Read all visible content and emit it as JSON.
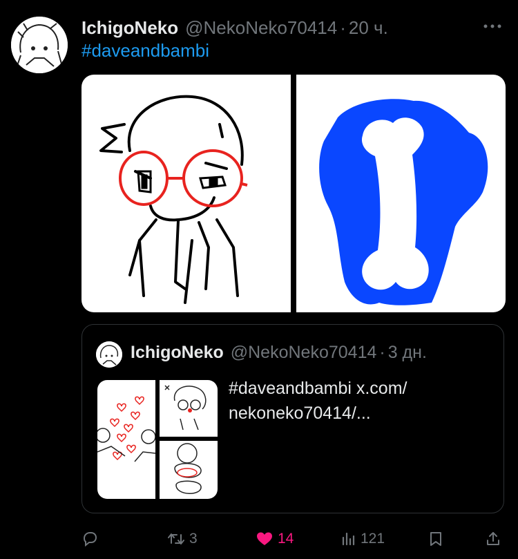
{
  "tweet": {
    "author_name": "IchigoNeko",
    "author_handle": "@NekoNeko70414",
    "separator": "·",
    "time": "20 ч.",
    "hashtag": "#daveandbambi"
  },
  "quote": {
    "author_name": "IchigoNeko",
    "author_handle": "@NekoNeko70414",
    "separator": "·",
    "time": "3 дн.",
    "text_line1": "#daveandbambi x.com/",
    "text_line2": "nekoneko70414/..."
  },
  "actions": {
    "retweets": "3",
    "likes": "14",
    "views": "121"
  },
  "colors": {
    "background": "#000000",
    "link": "#1d9bf0",
    "muted": "#71767b",
    "like_active": "#f91880",
    "drawing_blue": "#0a47ff",
    "drawing_red": "#e8231f"
  },
  "icons": [
    "more-icon",
    "reply-icon",
    "retweet-icon",
    "like-icon",
    "views-icon",
    "bookmark-icon",
    "share-icon"
  ]
}
